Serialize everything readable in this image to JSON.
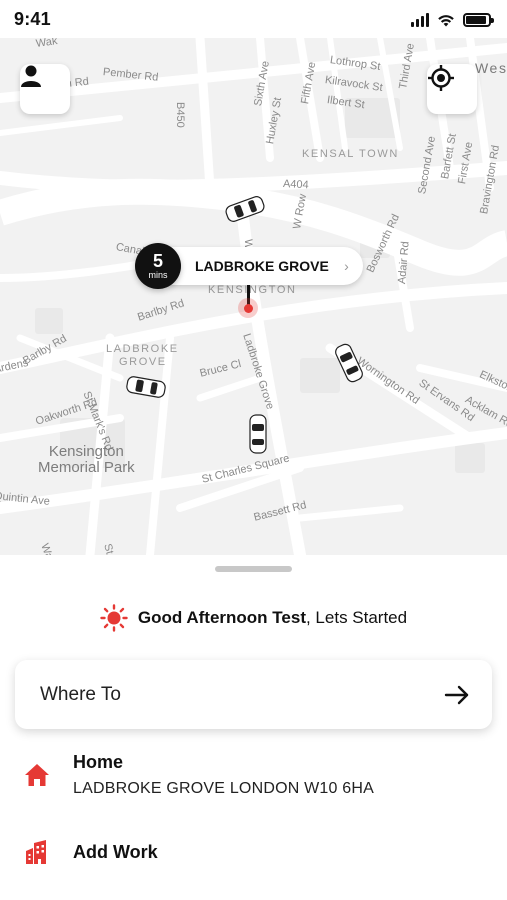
{
  "status_bar": {
    "time": "9:41",
    "battery_level": 0.9
  },
  "map": {
    "streets": [
      "Pember Rd",
      "Rainham Rd",
      "B450",
      "Sixth Ave",
      "Fifth Ave",
      "Lothrop St",
      "Kilravock St",
      "Ilbert St",
      "Huxley St",
      "Third Ave",
      "Second Ave",
      "Barfett St",
      "First Ave",
      "Bravington Rd",
      "A404",
      "W Row",
      "Bosworth Rd",
      "Adair Rd",
      "Barlby Rd",
      "Barlby Rd",
      "St Mark's Rd",
      "Bruce Cl",
      "Ladbroke Grove",
      "Wornington Rd",
      "St Ervans Rd",
      "Elkstone Rd",
      "Acklam Rd",
      "Oakworth Rd",
      "St Charles Square",
      "Bassett Rd",
      "Ardens",
      "Quintin Ave",
      "Walling",
      "St He",
      "Canal",
      "Wak",
      "Wes"
    ],
    "areas": {
      "kensal_town": "KENSAL TOWN",
      "kensington": "KENSINGTON",
      "ladbroke_grove_1": "LADBROKE",
      "ladbroke_grove_2": "GROVE"
    },
    "park_line1": "Kensington",
    "park_line2": "Memorial Park",
    "eta": {
      "value": "5",
      "unit": "mins",
      "destination": "LADBROKE GROVE",
      "chevron": "›"
    },
    "icons": {
      "profile": "person-icon",
      "locate": "crosshair-icon"
    }
  },
  "sheet": {
    "greeting_name": "Good Afternoon Test",
    "greeting_rest": ", Lets Started",
    "greeting_icon": "sun-icon",
    "where_to": {
      "label": "Where To",
      "icon": "arrow-right-icon"
    },
    "saved": [
      {
        "title": "Home",
        "subtitle": "LADBROKE GROVE LONDON W10 6HA",
        "icon": "home-icon"
      },
      {
        "title": "Add Work",
        "icon": "office-building-icon"
      }
    ]
  },
  "colors": {
    "accent": "#e53935",
    "text": "#111111",
    "map_bg": "#f2f2f2"
  }
}
